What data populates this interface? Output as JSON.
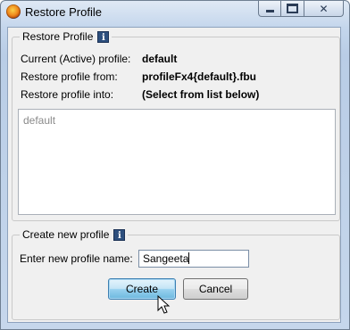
{
  "window": {
    "title": "Restore Profile",
    "app_icon": "firefox-icon",
    "controls": {
      "minimize": "minimize-icon",
      "maximize": "maximize-icon",
      "close": "close-icon",
      "close_glyph": "✕"
    }
  },
  "restore_group": {
    "legend": "Restore Profile",
    "info_glyph": "i",
    "rows": [
      {
        "label": "Current (Active) profile:",
        "value": "default"
      },
      {
        "label": "Restore profile from:",
        "value": "profileFx4{default}.fbu"
      },
      {
        "label": "Restore profile into:",
        "value": "(Select from list below)"
      }
    ],
    "profile_list": [
      "default"
    ]
  },
  "create_group": {
    "legend": "Create new profile",
    "info_glyph": "i",
    "name_label": "Enter new profile name:",
    "name_value": "Sangeeta"
  },
  "buttons": {
    "create": "Create",
    "cancel": "Cancel"
  },
  "colors": {
    "title_bar": "#c4d6ec",
    "client_bg": "#f0f0f0",
    "default_button": "#98d1ef",
    "info_icon": "#2d4f7e"
  }
}
